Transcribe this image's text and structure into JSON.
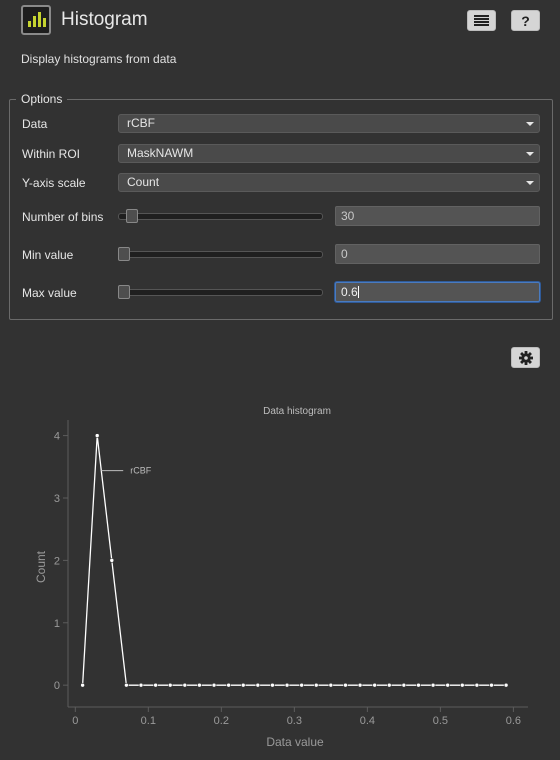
{
  "header": {
    "title": "Histogram",
    "list_icon": "list-icon",
    "help_label": "?"
  },
  "description": "Display histograms from data",
  "options": {
    "legend": "Options",
    "data": {
      "label": "Data",
      "value": "rCBF"
    },
    "roi": {
      "label": "Within ROI",
      "value": "MaskNAWM"
    },
    "yscale": {
      "label": "Y-axis scale",
      "value": "Count"
    },
    "bins": {
      "label": "Number of bins",
      "value": "30",
      "slider_fraction": 0.04
    },
    "min": {
      "label": "Min value",
      "value": "0",
      "slider_fraction": 0.0
    },
    "max": {
      "label": "Max value",
      "value": "0.6",
      "slider_fraction": 0.0
    }
  },
  "settings_icon": "gear-icon",
  "colors": {
    "background": "#323232",
    "accent": "#c6d430",
    "focus": "#4a7bbf"
  },
  "chart_data": {
    "type": "line",
    "title": "Data histogram",
    "xlabel": "Data value",
    "ylabel": "Count",
    "xlim": [
      -0.01,
      0.62
    ],
    "ylim": [
      -0.35,
      4.25
    ],
    "xticks": [
      0,
      0.1,
      0.2,
      0.3,
      0.4,
      0.5,
      0.6
    ],
    "xtick_labels": [
      "0",
      "0.1",
      "0.2",
      "0.3",
      "0.4",
      "0.5",
      "0.6"
    ],
    "yticks": [
      0,
      1,
      2,
      3,
      4
    ],
    "ytick_labels": [
      "0",
      "1",
      "2",
      "3",
      "4"
    ],
    "series": [
      {
        "name": "rCBF",
        "x": [
          0.01,
          0.03,
          0.05,
          0.07,
          0.09,
          0.11,
          0.13,
          0.15,
          0.17,
          0.19,
          0.21,
          0.23,
          0.25,
          0.27,
          0.29,
          0.31,
          0.33,
          0.35,
          0.37,
          0.39,
          0.41,
          0.43,
          0.45,
          0.47,
          0.49,
          0.51,
          0.53,
          0.55,
          0.57,
          0.59
        ],
        "y": [
          0,
          4,
          2,
          0,
          0,
          0,
          0,
          0,
          0,
          0,
          0,
          0,
          0,
          0,
          0,
          0,
          0,
          0,
          0,
          0,
          0,
          0,
          0,
          0,
          0,
          0,
          0,
          0,
          0,
          0
        ]
      }
    ]
  }
}
